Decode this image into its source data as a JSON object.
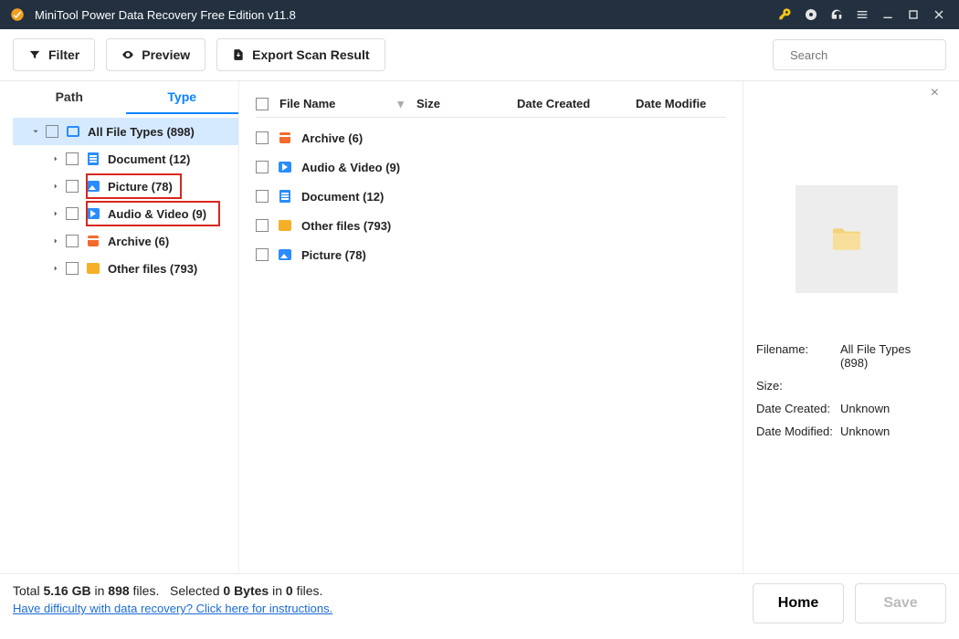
{
  "title": "MiniTool Power Data Recovery Free Edition v11.8",
  "toolbar": {
    "filter": "Filter",
    "preview": "Preview",
    "export": "Export Scan Result"
  },
  "search_placeholder": "Search",
  "tabs": {
    "path": "Path",
    "type": "Type"
  },
  "tree": {
    "root": "All File Types (898)",
    "items": [
      {
        "label": "Document (12)",
        "icon": "doc"
      },
      {
        "label": "Picture (78)",
        "icon": "pic",
        "hi": "picture"
      },
      {
        "label": "Audio & Video (9)",
        "icon": "av",
        "hi": "av"
      },
      {
        "label": "Archive (6)",
        "icon": "arch"
      },
      {
        "label": "Other files (793)",
        "icon": "other"
      }
    ]
  },
  "table": {
    "columns": {
      "name": "File Name",
      "size": "Size",
      "created": "Date Created",
      "modified": "Date Modifie"
    },
    "rows": [
      {
        "label": "Archive (6)",
        "icon": "arch"
      },
      {
        "label": "Audio & Video (9)",
        "icon": "av"
      },
      {
        "label": "Document (12)",
        "icon": "doc"
      },
      {
        "label": "Other files (793)",
        "icon": "other"
      },
      {
        "label": "Picture (78)",
        "icon": "pic"
      }
    ]
  },
  "details": {
    "filename_k": "Filename:",
    "filename_v": "All File Types (898)",
    "size_k": "Size:",
    "size_v": "",
    "created_k": "Date Created:",
    "created_v": "Unknown",
    "modified_k": "Date Modified:",
    "modified_v": "Unknown"
  },
  "footer": {
    "total_pre": "Total ",
    "total_size": "5.16 GB",
    "total_mid": " in ",
    "total_files": "898",
    "total_suf": " files.",
    "sel_pre": "Selected ",
    "sel_bytes": "0 Bytes",
    "sel_mid": " in ",
    "sel_files": "0",
    "sel_suf": " files.",
    "help": "Have difficulty with data recovery? Click here for instructions.",
    "home": "Home",
    "save": "Save"
  }
}
